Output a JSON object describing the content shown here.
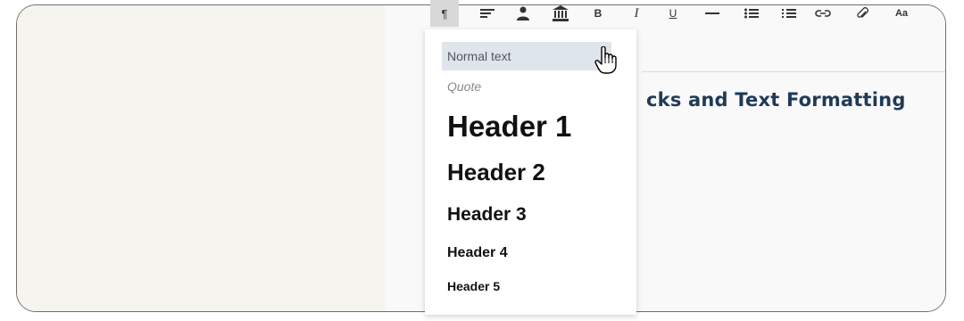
{
  "toolbar": {
    "items": [
      {
        "name": "paragraph-style",
        "glyph": "¶",
        "active": true
      },
      {
        "name": "align",
        "icon": "align-left-icon"
      },
      {
        "name": "person",
        "icon": "person-icon"
      },
      {
        "name": "institution",
        "icon": "bank-icon"
      },
      {
        "name": "bold",
        "glyph": "B"
      },
      {
        "name": "italic",
        "glyph": "I"
      },
      {
        "name": "underline",
        "glyph": "U"
      },
      {
        "name": "horizontal-rule",
        "icon": "horizontal-rule-icon"
      },
      {
        "name": "bullet-list",
        "icon": "bullet-list-icon"
      },
      {
        "name": "numbered-list",
        "icon": "numbered-list-icon"
      },
      {
        "name": "link",
        "icon": "link-icon"
      },
      {
        "name": "attachment",
        "icon": "paperclip-icon"
      },
      {
        "name": "font-case",
        "glyph": "Aa"
      }
    ]
  },
  "document": {
    "title_visible": "cks and Text Formatting"
  },
  "dropdown": {
    "options": [
      {
        "label": "Normal text",
        "style": "normal",
        "highlighted": true
      },
      {
        "label": "Quote",
        "style": "quote"
      },
      {
        "label": "Header 1",
        "style": "h1"
      },
      {
        "label": "Header 2",
        "style": "h2"
      },
      {
        "label": "Header 3",
        "style": "h3"
      },
      {
        "label": "Header 4",
        "style": "h4"
      },
      {
        "label": "Header 5",
        "style": "h5"
      }
    ]
  },
  "colors": {
    "background_left": "#f6f4ef",
    "editor_bg": "#f9f9f9",
    "highlight": "#dfe5ec",
    "title_color": "#1f3a57"
  }
}
